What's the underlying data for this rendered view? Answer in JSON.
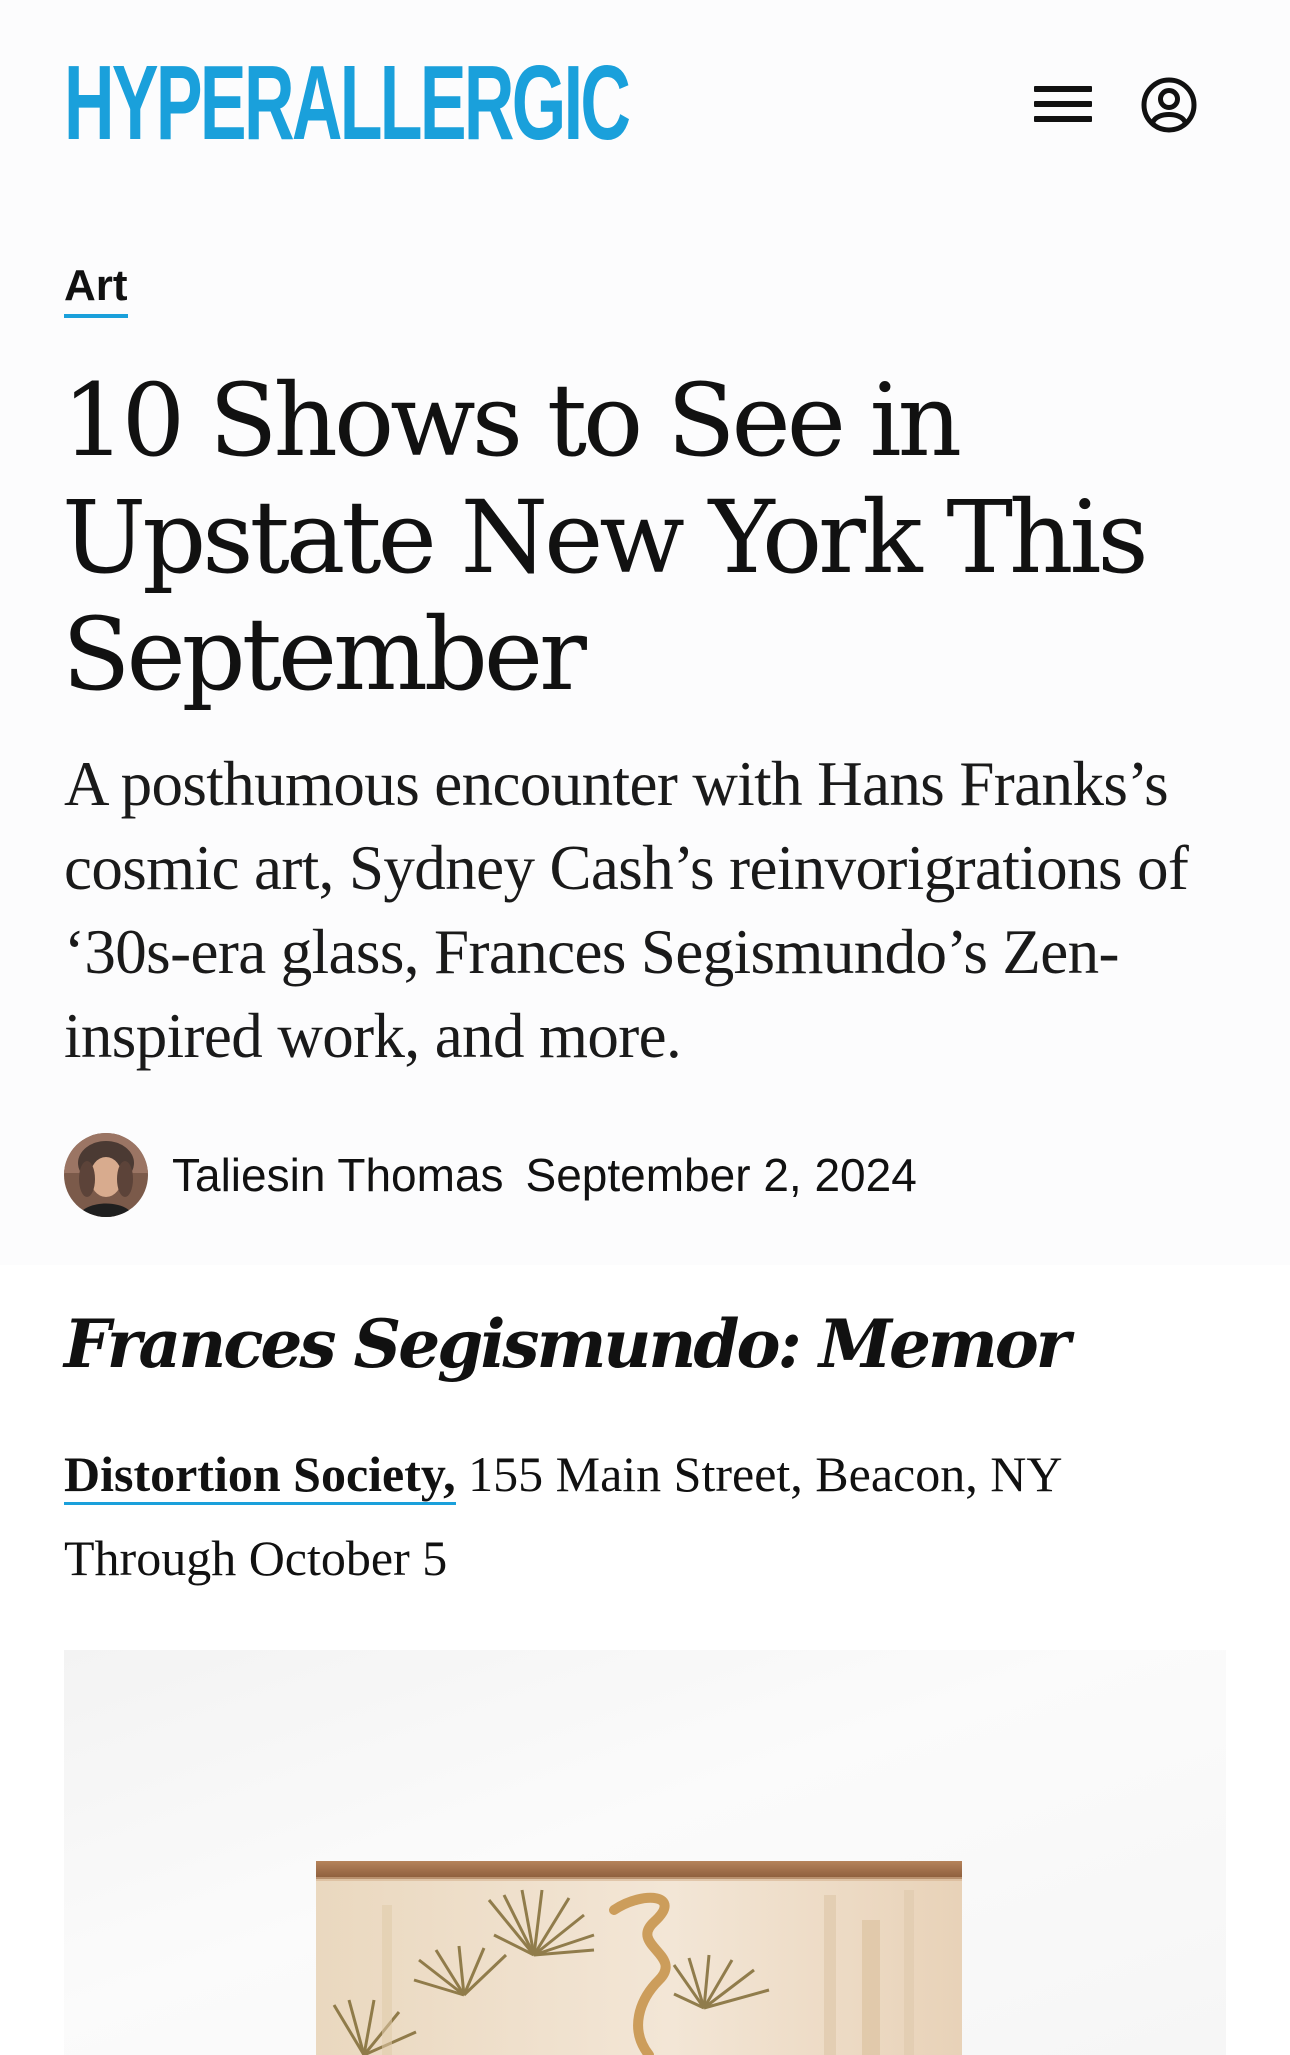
{
  "header": {
    "logo_text": "HYPERALLERGIC",
    "menu_icon": "hamburger-menu-icon",
    "account_icon": "account-icon",
    "brand_color": "#1aa0db"
  },
  "article": {
    "category": "Art",
    "headline": "10 Shows to See in Upstate New York This September",
    "dek": "A posthumous encounter with Hans Franks’s cosmic art, Sydney Cash’s reinvorigrations of ‘30s-era glass, Frances Segismundo’s Zen-inspired work, and more.",
    "author": "Taliesin Thomas",
    "date": "September 2, 2024"
  },
  "section": {
    "title": "Frances Segismundo: Memor",
    "venue_name": "Distortion Society,",
    "venue_address": " 155 Main Street, Beacon, NY",
    "dates": "Through October 5"
  }
}
